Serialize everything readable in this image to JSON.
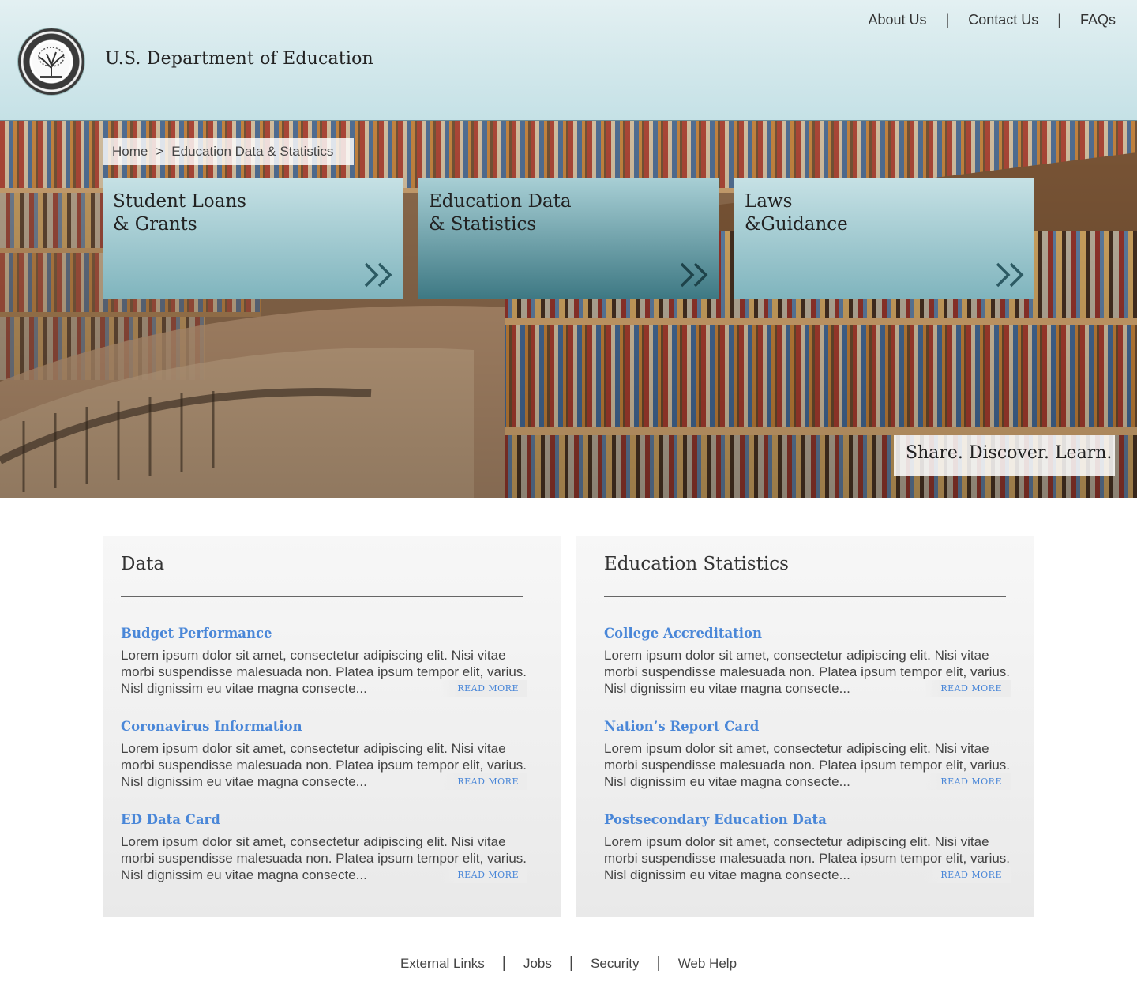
{
  "header": {
    "site_title": "U.S. Department of Education",
    "nav": [
      "About Us",
      "Contact Us",
      "FAQs"
    ],
    "separator": "|"
  },
  "breadcrumb": {
    "home": "Home",
    "separator": ">",
    "current": "Education Data & Statistics"
  },
  "tiles": [
    {
      "line1": "Student Loans",
      "line2": "& Grants"
    },
    {
      "line1": "Education Data",
      "line2": "& Statistics",
      "active": true
    },
    {
      "line1": "Laws",
      "line2": "&Guidance"
    }
  ],
  "tagline": "Share. Discover. Learn.",
  "panels": [
    {
      "heading": "Data",
      "items": [
        {
          "title": "Budget Performance",
          "body": "Lorem ipsum dolor sit amet, consectetur adipiscing elit. Nisi vitae morbi suspendisse malesuada non. Platea ipsum tempor elit, varius. Nisl dignissim eu vitae magna consecte...",
          "read_more": "READ MORE"
        },
        {
          "title": "Coronavirus Information",
          "body": "Lorem ipsum dolor sit amet, consectetur adipiscing elit. Nisi vitae morbi suspendisse malesuada non. Platea ipsum tempor elit, varius. Nisl dignissim eu vitae magna consecte...",
          "read_more": "READ MORE"
        },
        {
          "title": "ED Data Card",
          "body": "Lorem ipsum dolor sit amet, consectetur adipiscing elit. Nisi vitae morbi suspendisse malesuada non. Platea ipsum tempor elit, varius. Nisl dignissim eu vitae magna consecte...",
          "read_more": "READ MORE"
        }
      ]
    },
    {
      "heading": "Education Statistics",
      "items": [
        {
          "title": "College Accreditation",
          "body": "Lorem ipsum dolor sit amet, consectetur adipiscing elit. Nisi vitae morbi suspendisse malesuada non. Platea ipsum tempor elit, varius. Nisl dignissim eu vitae magna consecte...",
          "read_more": "READ MORE"
        },
        {
          "title": "Nation’s Report Card",
          "body": "Lorem ipsum dolor sit amet, consectetur adipiscing elit. Nisi vitae morbi suspendisse malesuada non. Platea ipsum tempor elit, varius. Nisl dignissim eu vitae magna consecte...",
          "read_more": "READ MORE"
        },
        {
          "title": "Postsecondary Education Data",
          "body": "Lorem ipsum dolor sit amet, consectetur adipiscing elit. Nisi vitae morbi suspendisse malesuada non. Platea ipsum tempor elit, varius. Nisl dignissim eu vitae magna consecte...",
          "read_more": "READ MORE"
        }
      ]
    }
  ],
  "footer": {
    "links": [
      "External Links",
      "Jobs",
      "Security",
      "Web Help"
    ],
    "separator": "|"
  },
  "icons": {
    "seal": "department-seal-icon",
    "tile_arrow": "double-chevron-right-icon"
  },
  "colors": {
    "link": "#4a87d8",
    "header_bg": "#d4e9ec",
    "tile": "#9ec8cf",
    "tile_active": "#3d7883"
  }
}
